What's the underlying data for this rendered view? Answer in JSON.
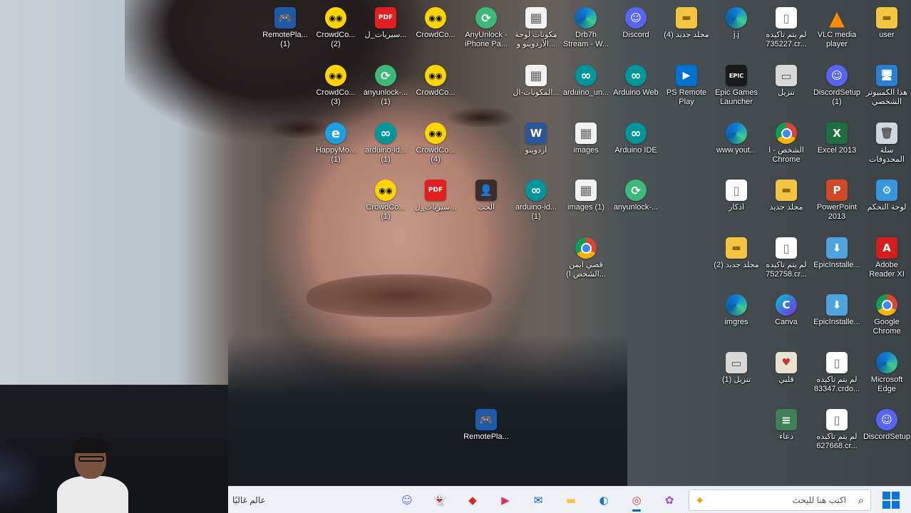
{
  "desktop": {
    "icons": [
      {
        "label": "RemotePla...\n(1)",
        "icon": "remote-play"
      },
      {
        "label": "CrowdCo...\n(2)",
        "icon": "crowdcontrol"
      },
      {
        "label": "سيريات_ل...",
        "icon": "pdf"
      },
      {
        "label": "CrowdCo...",
        "icon": "crowdcontrol"
      },
      {
        "label": "AnyUnlock -\niPhone Pa...",
        "icon": "anyunlock"
      },
      {
        "label": "مكونات لوحة\nالأردوينو و...",
        "icon": "spreadsheet"
      },
      {
        "label": "Drb7h\nStream - W...",
        "icon": "edge"
      },
      {
        "label": "Discord",
        "icon": "discord"
      },
      {
        "label": "مجلد جديد (4)",
        "icon": "folder"
      },
      {
        "label": "j.j",
        "icon": "edge"
      },
      {
        "label": "لم يتم تأكيده\n735227.cr...",
        "icon": "file"
      },
      {
        "label": "VLC media\nplayer",
        "icon": "vlc"
      },
      {
        "label": "user",
        "icon": "folder"
      },
      {
        "label": "CrowdCo...\n(3)",
        "icon": "crowdcontrol"
      },
      {
        "label": "anyunlock-...\n(1)",
        "icon": "anyunlock"
      },
      {
        "label": "CrowdCo...",
        "icon": "crowdcontrol"
      },
      {
        "label": "المكونات-ال...",
        "icon": "spreadsheet"
      },
      {
        "label": "arduino_un...",
        "icon": "arduino"
      },
      {
        "label": "Arduino Web",
        "icon": "arduino"
      },
      {
        "label": "PS Remote\nPlay",
        "icon": "ps"
      },
      {
        "label": "Epic Games\nLauncher",
        "icon": "epic"
      },
      {
        "label": "تنزيل",
        "icon": "drive"
      },
      {
        "label": "DiscordSetup\n(1)",
        "icon": "discord"
      },
      {
        "label": "هذا الكمبيوتر\nالشخصي",
        "icon": "pc"
      },
      {
        "label": "HappyMo...\n(1)",
        "icon": "ie"
      },
      {
        "label": "arduino-id...\n(1)",
        "icon": "arduino"
      },
      {
        "label": "CrowdCo...\n(4)",
        "icon": "crowdcontrol"
      },
      {
        "label": "أردوينو",
        "icon": "word"
      },
      {
        "label": "images",
        "icon": "spreadsheet"
      },
      {
        "label": "Arduino IDE",
        "icon": "arduino"
      },
      {
        "label": "www.yout...",
        "icon": "edge"
      },
      {
        "label": "الشخص - ا\nChrome",
        "icon": "chrome"
      },
      {
        "label": "Excel 2013",
        "icon": "excel"
      },
      {
        "label": "سلة\nالمحذوفات",
        "icon": "trash"
      },
      {
        "label": "CrowdCo...\n(1)",
        "icon": "crowdcontrol"
      },
      {
        "label": "سيريات_ل...",
        "icon": "pdf"
      },
      {
        "label": "الحب",
        "icon": "photo"
      },
      {
        "label": "arduino-id...\n(1)",
        "icon": "arduino"
      },
      {
        "label": "images (1)",
        "icon": "spreadsheet"
      },
      {
        "label": "anyunlock-...",
        "icon": "anyunlock"
      },
      {
        "label": "أذكار",
        "icon": "file"
      },
      {
        "label": "مجلد جديد",
        "icon": "folder"
      },
      {
        "label": "PowerPoint\n2013",
        "icon": "ppt"
      },
      {
        "label": "لوحة التحكم",
        "icon": "control"
      },
      {
        "label": "قصي ايمن\n(الشخص ا...",
        "icon": "chrome"
      },
      {
        "label": "مجلد جديد (2)",
        "icon": "folder"
      },
      {
        "label": "لم يتم تأكيده\n752758.cr...",
        "icon": "file"
      },
      {
        "label": "EpicInstalle...",
        "icon": "installer"
      },
      {
        "label": "Adobe\nReader XI",
        "icon": "adobe"
      },
      {
        "label": "imgres",
        "icon": "edge"
      },
      {
        "label": "Canva",
        "icon": "canva"
      },
      {
        "label": "EpicInstalle...",
        "icon": "installer"
      },
      {
        "label": "Google\nChrome",
        "icon": "chrome"
      },
      {
        "label": "تنزيل (1)",
        "icon": "drive"
      },
      {
        "label": "قلبي",
        "icon": "heart"
      },
      {
        "label": "لم يتم تأكيده\n83347.crdo...",
        "icon": "file"
      },
      {
        "label": "Microsoft\nEdge",
        "icon": "edge"
      },
      {
        "label": "RemotePla...",
        "icon": "remote-play"
      },
      {
        "label": "دعاء",
        "icon": "notes"
      },
      {
        "label": "لم يتم تأكيده\n627668.cr...",
        "icon": "file"
      },
      {
        "label": "DiscordSetup",
        "icon": "discord"
      }
    ]
  },
  "taskbar": {
    "weather_text": "عالم غالبًا",
    "apps": [
      {
        "name": "discord",
        "glyph": "☺",
        "color": "#5865f2"
      },
      {
        "name": "snapchat",
        "glyph": "👻",
        "color": "#fffc00"
      },
      {
        "name": "game",
        "glyph": "◆",
        "color": "#d22"
      },
      {
        "name": "video-editor",
        "glyph": "▶",
        "color": "#e52d5a"
      },
      {
        "name": "outlook",
        "glyph": "✉",
        "color": "#0a64c8"
      },
      {
        "name": "file-explorer",
        "glyph": "▬",
        "color": "#f4c542"
      },
      {
        "name": "edge",
        "glyph": "◐",
        "color": "#0f7bd8"
      },
      {
        "name": "chrome",
        "glyph": "◎",
        "color": "#db4437"
      },
      {
        "name": "copilot",
        "glyph": "✿",
        "color": "#a347e6"
      }
    ],
    "search": {
      "placeholder": "اكتب هنا للبحث"
    }
  }
}
